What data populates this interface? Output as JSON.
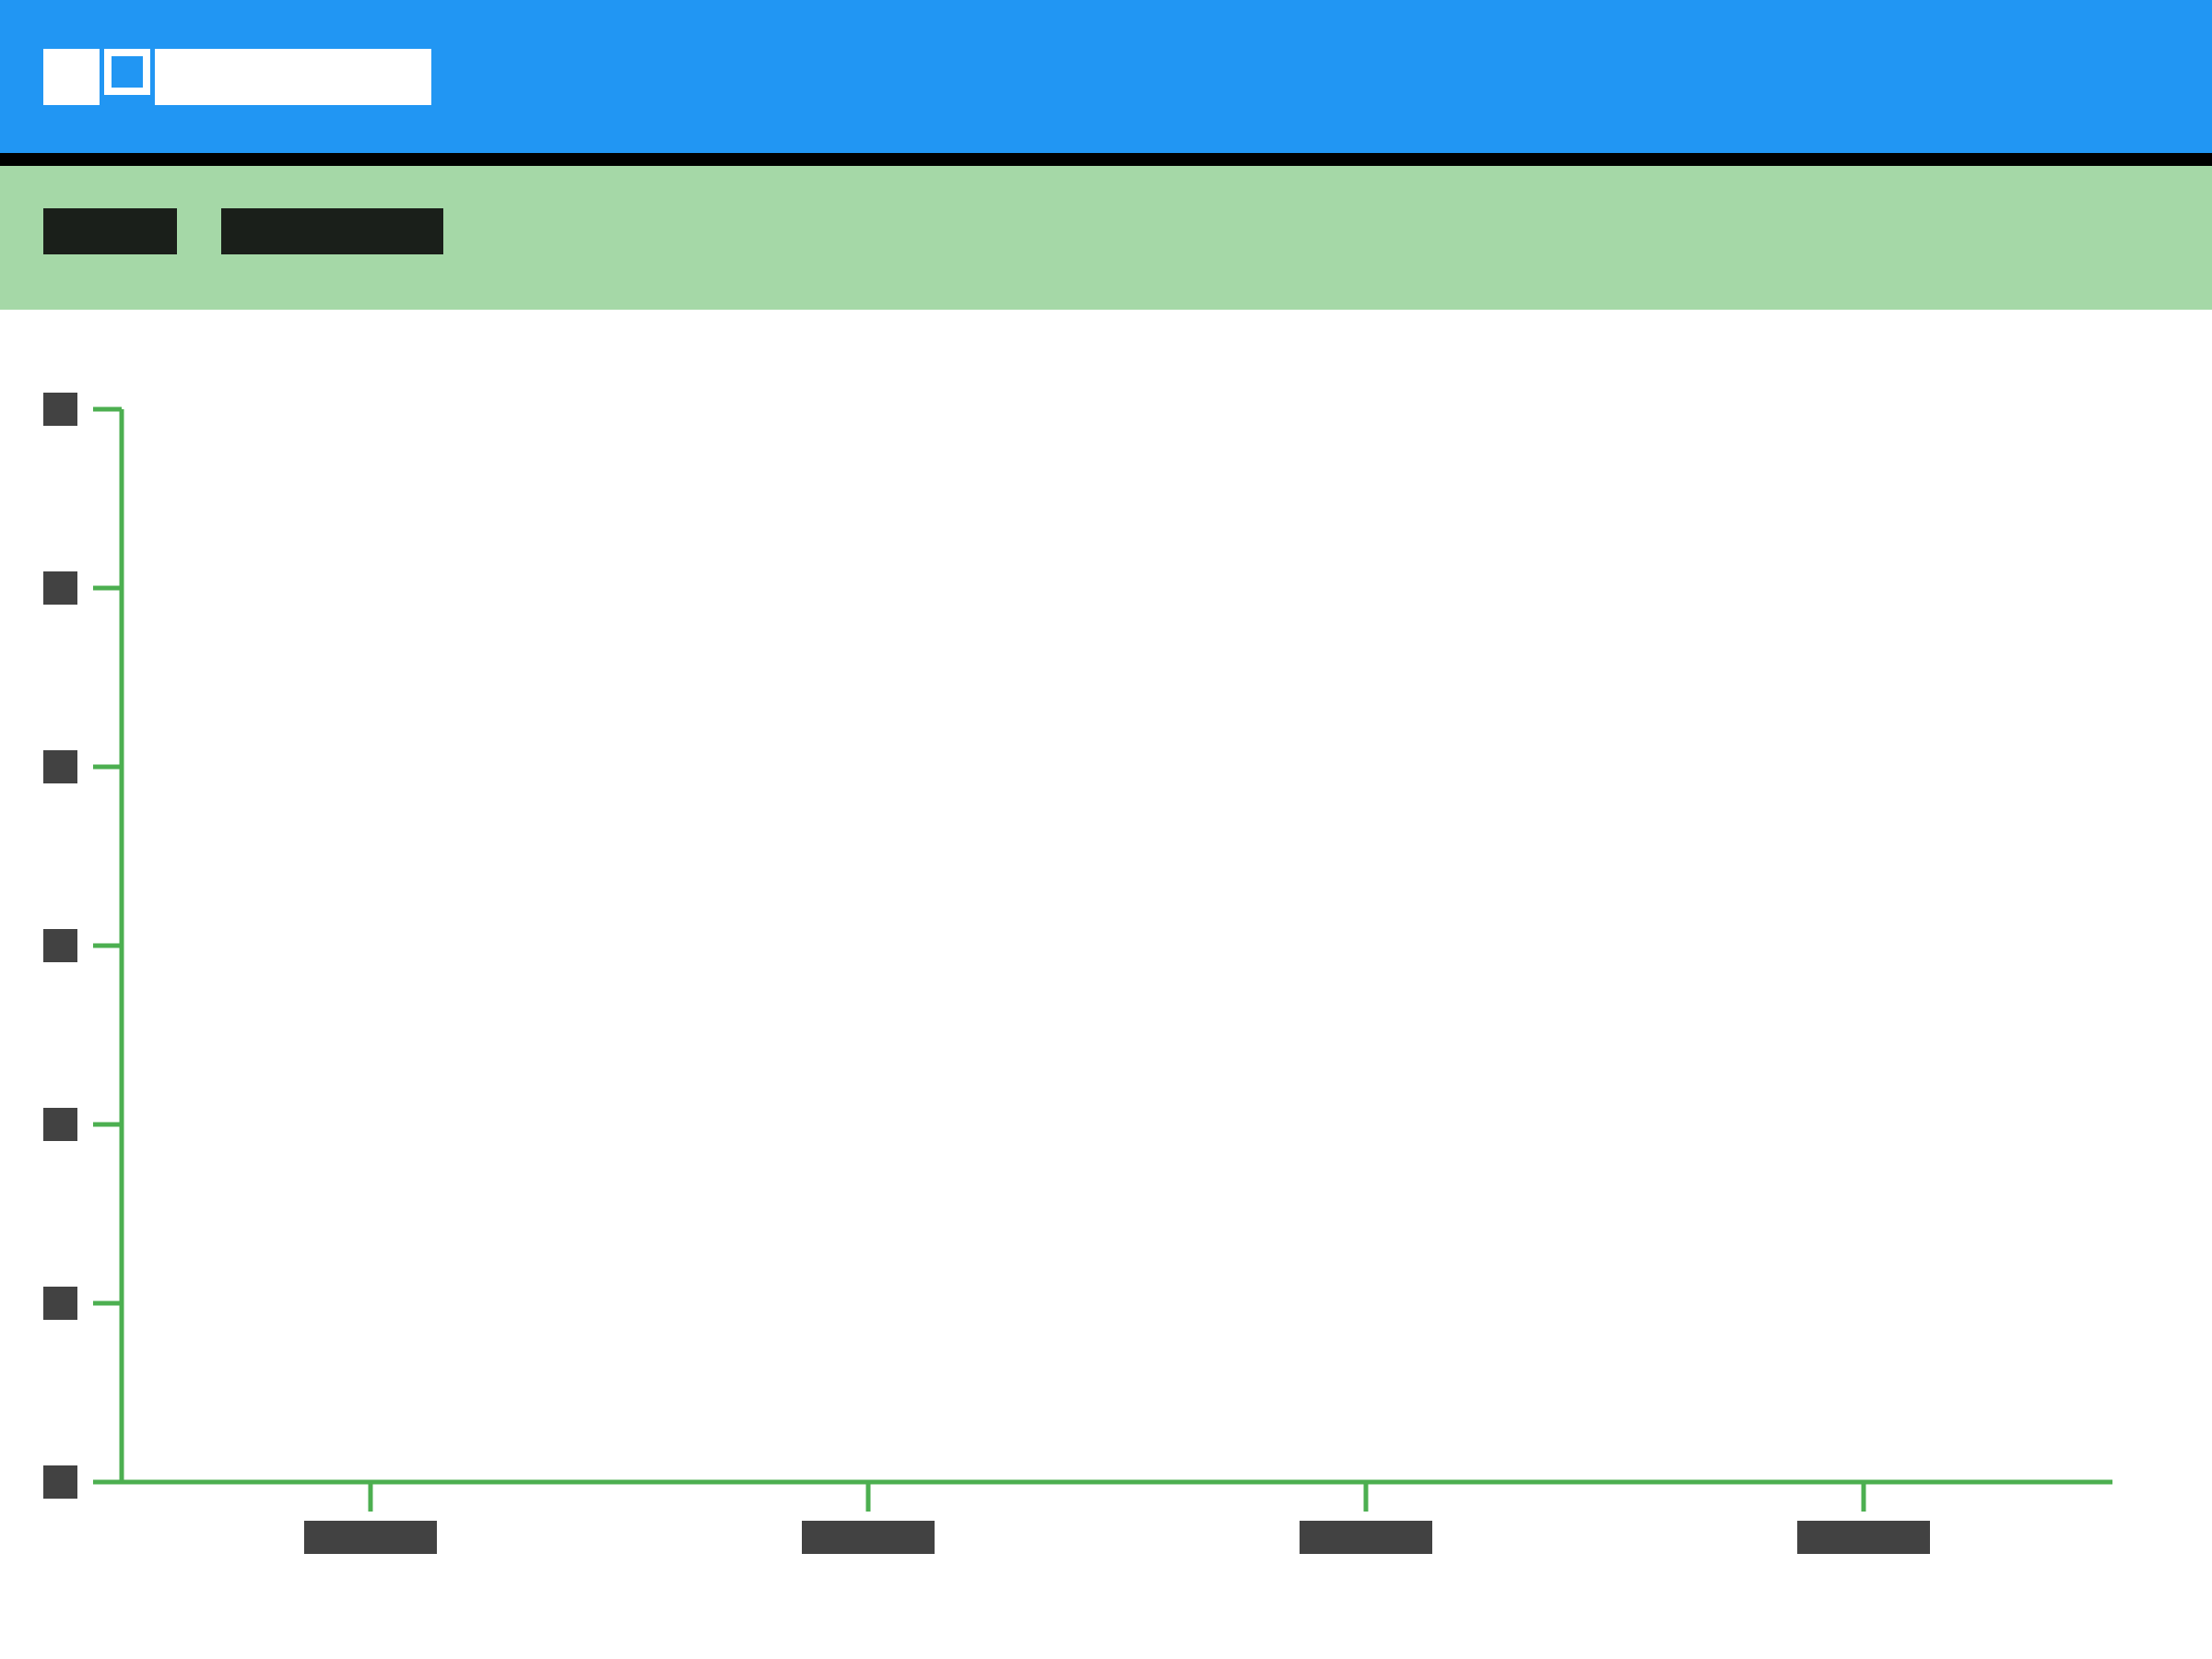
{
  "app_bar": {
    "title": "",
    "icon": "app-window-icon",
    "color": "#2196f3"
  },
  "toolbar": {
    "color": "#a5d8a7",
    "buttons": [
      {
        "label": ""
      },
      {
        "label": ""
      }
    ]
  },
  "chart_data": {
    "type": "line",
    "title": "",
    "xlabel": "",
    "ylabel": "",
    "categories": [
      "",
      "",
      "",
      ""
    ],
    "y_ticks": [
      "",
      "",
      "",
      "",
      "",
      "",
      ""
    ],
    "series": [],
    "grid": false,
    "axis_color": "#4caf50",
    "tick_label_color": "#424242"
  }
}
